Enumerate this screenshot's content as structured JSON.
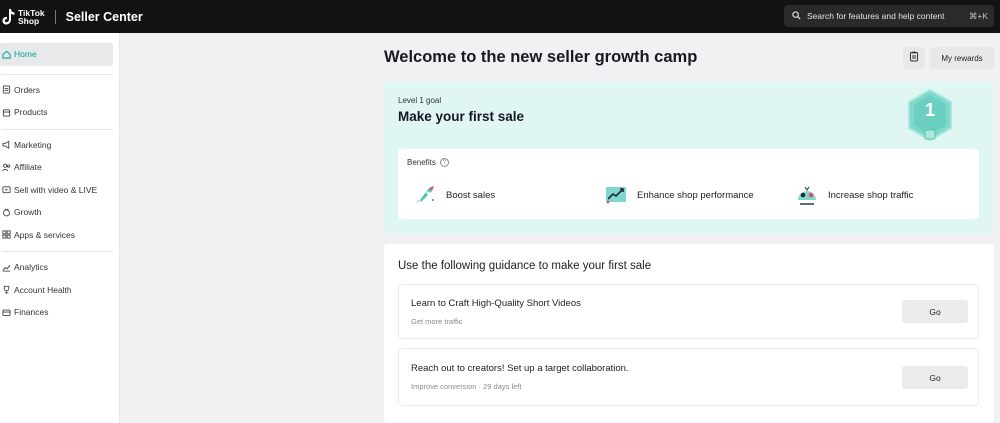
{
  "topbar": {
    "logo_line1": "TikTok",
    "logo_line2": "Shop",
    "app_title": "Seller Center",
    "search_placeholder": "Search for features and help content",
    "search_shortcut": "⌘+K"
  },
  "sidebar": {
    "groups": [
      [
        {
          "label": "Home",
          "icon": "home-icon",
          "active": true
        }
      ],
      [
        {
          "label": "Orders",
          "icon": "orders-icon"
        },
        {
          "label": "Products",
          "icon": "products-icon"
        }
      ],
      [
        {
          "label": "Marketing",
          "icon": "megaphone-icon"
        },
        {
          "label": "Affiliate",
          "icon": "affiliate-icon"
        },
        {
          "label": "Sell with video & LIVE",
          "icon": "video-icon"
        },
        {
          "label": "Growth",
          "icon": "growth-icon"
        },
        {
          "label": "Apps & services",
          "icon": "apps-icon"
        }
      ],
      [
        {
          "label": "Analytics",
          "icon": "analytics-icon"
        },
        {
          "label": "Account Health",
          "icon": "trophy-icon"
        },
        {
          "label": "Finances",
          "icon": "finances-icon"
        }
      ]
    ]
  },
  "main": {
    "title": "Welcome to the new seller growth camp",
    "rewards_label": "My rewards",
    "goal": {
      "level": "Level 1 goal",
      "title": "Make your first sale",
      "badge_number": "1",
      "benefits_label": "Benefits",
      "benefits": [
        {
          "label": "Boost sales",
          "icon": "rocket-icon"
        },
        {
          "label": "Enhance shop performance",
          "icon": "chart-up-icon"
        },
        {
          "label": "Increase shop traffic",
          "icon": "traffic-icon"
        }
      ]
    },
    "guidance": {
      "title": "Use the following guidance to make your first sale",
      "tasks": [
        {
          "title": "Learn to Craft High-Quality Short Videos",
          "sub": "Get more traffic",
          "button": "Go"
        },
        {
          "title": "Reach out to creators! Set up a target collaboration.",
          "sub": "Improve conversion · 29 days left",
          "button": "Go"
        }
      ]
    }
  },
  "colors": {
    "accent": "#0aa39a",
    "goal_bg": "#dff6f2",
    "topbar": "#121212"
  }
}
